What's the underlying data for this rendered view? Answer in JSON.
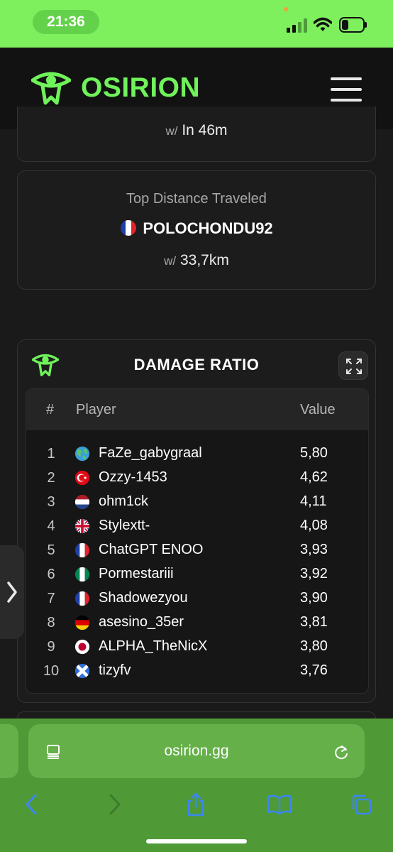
{
  "status_bar": {
    "time": "21:36"
  },
  "header": {
    "brand": "OSIRION"
  },
  "previous_card": {
    "prefix": "w/",
    "value": "In 46m"
  },
  "distance_card": {
    "label": "Top Distance Traveled",
    "player": "POLOCHONDU92",
    "flag": "fr",
    "prefix": "w/",
    "value": "33,7km"
  },
  "ranking": {
    "title": "DAMAGE RATIO",
    "columns": {
      "rank": "#",
      "player": "Player",
      "value": "Value"
    },
    "rows": [
      {
        "rank": "1",
        "flag": "globe",
        "player": "FaZe_gabygraal",
        "value": "5,80"
      },
      {
        "rank": "2",
        "flag": "tr",
        "player": "Ozzy-1453",
        "value": "4,62"
      },
      {
        "rank": "3",
        "flag": "nl",
        "player": "ohm1ck",
        "value": "4,11"
      },
      {
        "rank": "4",
        "flag": "gb",
        "player": "Stylextt-",
        "value": "4,08"
      },
      {
        "rank": "5",
        "flag": "fr",
        "player": "ChatGPT ENOO",
        "value": "3,93"
      },
      {
        "rank": "6",
        "flag": "ng",
        "player": "Pormestariii",
        "value": "3,92"
      },
      {
        "rank": "7",
        "flag": "fr",
        "player": "Shadowezyou",
        "value": "3,90"
      },
      {
        "rank": "8",
        "flag": "de",
        "player": "asesino_35er",
        "value": "3,81"
      },
      {
        "rank": "9",
        "flag": "jp",
        "player": "ALPHA_TheNicX",
        "value": "3,80"
      },
      {
        "rank": "10",
        "flag": "sc",
        "player": "tizyfv",
        "value": "3,76"
      }
    ]
  },
  "browser": {
    "address": "osirion.gg"
  },
  "colors": {
    "accent": "#6ff25a",
    "status_bar": "#7ef05e",
    "browser": "#4f9a36",
    "card": "#1c1c1c"
  }
}
